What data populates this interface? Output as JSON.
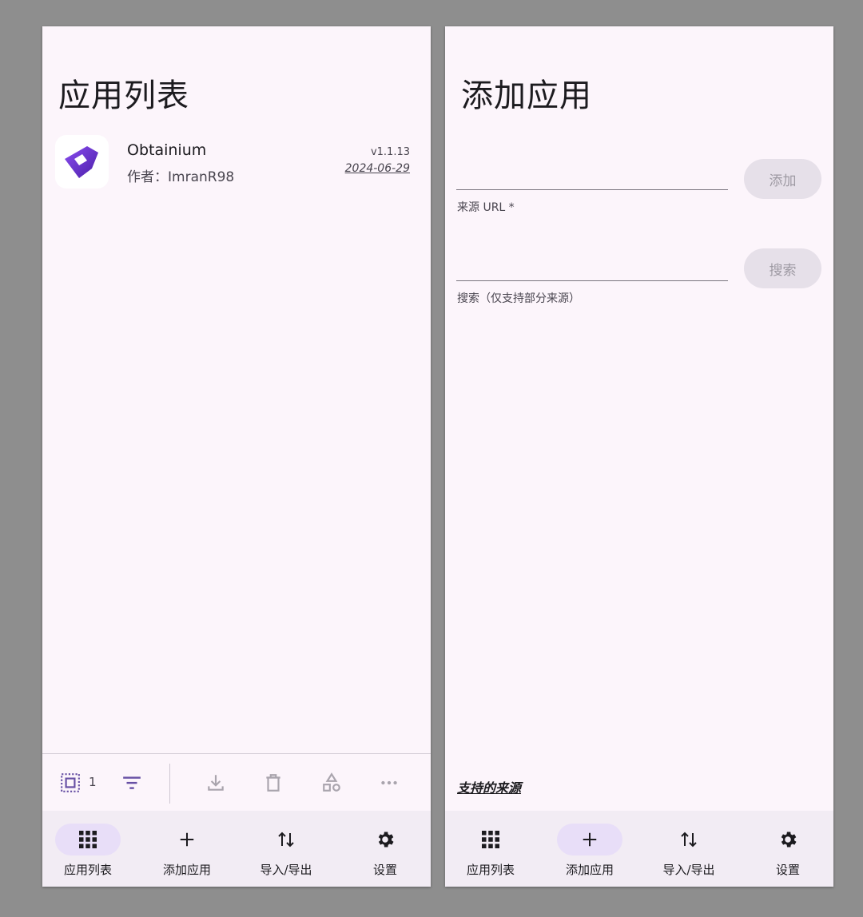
{
  "left_screen": {
    "title": "应用列表",
    "app": {
      "name": "Obtainium",
      "author": "作者：ImranR98",
      "version": "v1.1.13",
      "date": "2024-06-29",
      "icon": "obtainium-logo"
    },
    "toolbar": {
      "selected_count": "1",
      "icons": [
        "select-all-icon",
        "filter-icon",
        "download-icon",
        "delete-icon",
        "categories-icon",
        "more-icon"
      ]
    }
  },
  "right_screen": {
    "title": "添加应用",
    "url_field": {
      "label": "来源 URL *",
      "value": ""
    },
    "add_button": "添加",
    "search_field": {
      "label": "搜索（仅支持部分来源）",
      "value": ""
    },
    "search_button": "搜索",
    "supported_sources_link": "支持的来源"
  },
  "nav": {
    "items": [
      {
        "label": "应用列表",
        "icon": "apps-grid-icon"
      },
      {
        "label": "添加应用",
        "icon": "add-icon"
      },
      {
        "label": "导入/导出",
        "icon": "import-export-icon"
      },
      {
        "label": "设置",
        "icon": "settings-gear-icon"
      }
    ]
  },
  "colors": {
    "surface": "#fcf5fb",
    "nav_background": "#f2ecf4",
    "active_indicator": "#e8def8",
    "brand_purple": "#6a2fd0",
    "disabled_button": "#e6e0e9"
  }
}
